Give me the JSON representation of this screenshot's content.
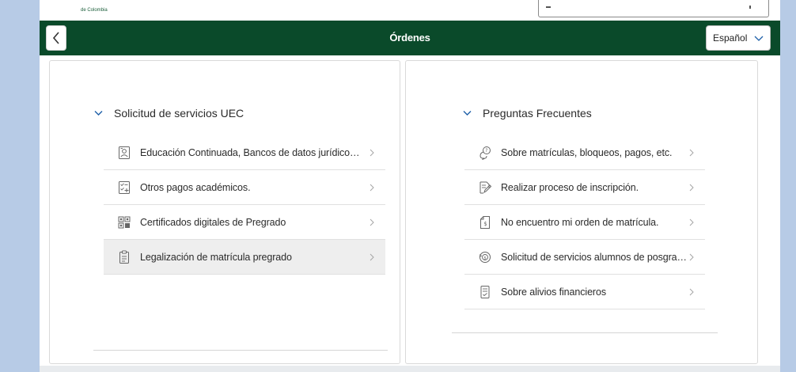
{
  "brand": {
    "text": "de Colombia"
  },
  "shell": {
    "title": "Órdenes",
    "language": "Español"
  },
  "left_panel": {
    "section_title": "Solicitud de servicios UEC",
    "items": [
      {
        "label": "Educación Continuada, Bancos de datos jurídicos y ...",
        "icon": "person-id-icon"
      },
      {
        "label": "Otros pagos académicos.",
        "icon": "checklist-add-icon"
      },
      {
        "label": "Certificados digitales de Pregrado",
        "icon": "qr-grid-icon"
      },
      {
        "label": "Legalización de matrícula pregrado",
        "icon": "clipboard-icon"
      }
    ],
    "selected_index": 3
  },
  "right_panel": {
    "section_title": "Preguntas Frecuentes",
    "items": [
      {
        "label": "Sobre matrículas, bloqueos, pagos, etc.",
        "icon": "faq-bubble-icon"
      },
      {
        "label": "Realizar proceso de inscripción.",
        "icon": "edit-document-icon"
      },
      {
        "label": "No encuentro mi orden de matrícula.",
        "icon": "document-money-icon"
      },
      {
        "label": "Solicitud de servicios alumnos de posgrados",
        "icon": "coin-cycle-icon"
      },
      {
        "label": "Sobre alivios financieros",
        "icon": "receipt-icon"
      }
    ]
  },
  "colors": {
    "shell_bar": "#0a4a2a",
    "page_bg": "#b7cbe6",
    "selected_row": "#eeeeee"
  }
}
